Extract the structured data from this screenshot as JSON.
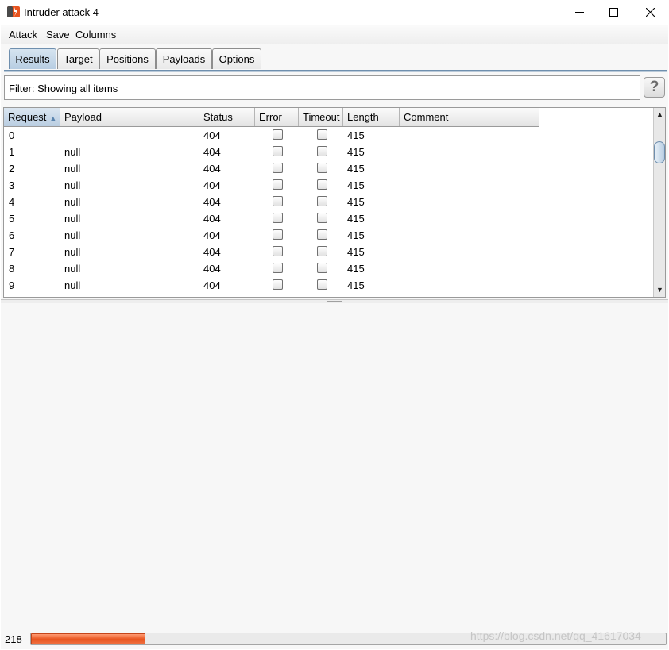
{
  "window": {
    "title": "Intruder attack 4",
    "minimize_glyph": "─",
    "maximize_glyph": "☐",
    "close_glyph": "✕"
  },
  "menu": {
    "items": [
      "Attack",
      "Save",
      "Columns"
    ]
  },
  "tabs": [
    {
      "label": "Results",
      "active": true
    },
    {
      "label": "Target",
      "active": false
    },
    {
      "label": "Positions",
      "active": false
    },
    {
      "label": "Payloads",
      "active": false
    },
    {
      "label": "Options",
      "active": false
    }
  ],
  "filter": {
    "text": "Filter: Showing all items",
    "help_label": "?"
  },
  "results_table": {
    "columns": [
      "Request",
      "Payload",
      "Status",
      "Error",
      "Timeout",
      "Length",
      "Comment"
    ],
    "sorted_column": "Request",
    "sort_glyph": "▲",
    "rows": [
      {
        "request": "0",
        "payload": "",
        "status": "404",
        "error": false,
        "timeout": false,
        "length": "415",
        "comment": ""
      },
      {
        "request": "1",
        "payload": "null",
        "status": "404",
        "error": false,
        "timeout": false,
        "length": "415",
        "comment": ""
      },
      {
        "request": "2",
        "payload": "null",
        "status": "404",
        "error": false,
        "timeout": false,
        "length": "415",
        "comment": ""
      },
      {
        "request": "3",
        "payload": "null",
        "status": "404",
        "error": false,
        "timeout": false,
        "length": "415",
        "comment": ""
      },
      {
        "request": "4",
        "payload": "null",
        "status": "404",
        "error": false,
        "timeout": false,
        "length": "415",
        "comment": ""
      },
      {
        "request": "5",
        "payload": "null",
        "status": "404",
        "error": false,
        "timeout": false,
        "length": "415",
        "comment": ""
      },
      {
        "request": "6",
        "payload": "null",
        "status": "404",
        "error": false,
        "timeout": false,
        "length": "415",
        "comment": ""
      },
      {
        "request": "7",
        "payload": "null",
        "status": "404",
        "error": false,
        "timeout": false,
        "length": "415",
        "comment": ""
      },
      {
        "request": "8",
        "payload": "null",
        "status": "404",
        "error": false,
        "timeout": false,
        "length": "415",
        "comment": ""
      },
      {
        "request": "9",
        "payload": "null",
        "status": "404",
        "error": false,
        "timeout": false,
        "length": "415",
        "comment": ""
      }
    ],
    "scroll_up_glyph": "▲",
    "scroll_down_glyph": "▼"
  },
  "status": {
    "count": "218",
    "progress_fraction": 0.18,
    "progress_color": "#e8541f"
  },
  "watermark": "https://blog.csdn.net/qq_41617034",
  "colors": {
    "accent": "#b7cde2",
    "brand_icon": "#e8541f"
  }
}
